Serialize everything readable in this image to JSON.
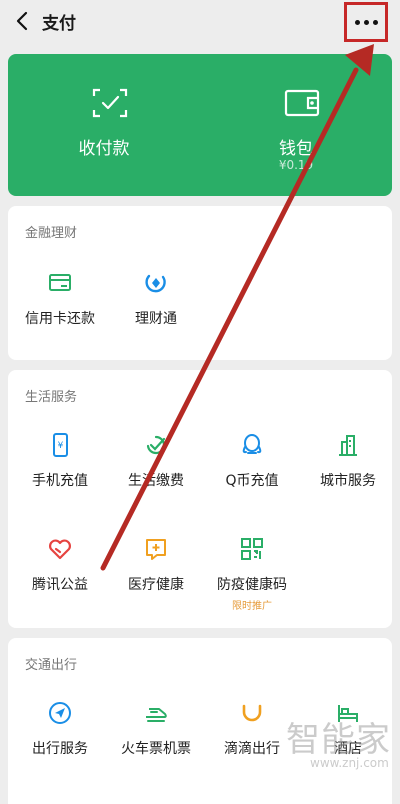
{
  "header": {
    "title": "支付"
  },
  "hero": {
    "items": [
      {
        "label": "收付款"
      },
      {
        "label": "钱包",
        "sub": "¥0.19"
      }
    ]
  },
  "finance": {
    "title": "金融理财",
    "items": [
      {
        "label": "信用卡还款"
      },
      {
        "label": "理财通"
      }
    ]
  },
  "life": {
    "title": "生活服务",
    "items": [
      {
        "label": "手机充值"
      },
      {
        "label": "生活缴费"
      },
      {
        "label": "Q币充值"
      },
      {
        "label": "城市服务"
      },
      {
        "label": "腾讯公益"
      },
      {
        "label": "医疗健康"
      },
      {
        "label": "防疫健康码",
        "tag": "限时推广"
      }
    ]
  },
  "transport": {
    "title": "交通出行",
    "items": [
      {
        "label": "出行服务"
      },
      {
        "label": "火车票机票"
      },
      {
        "label": "滴滴出行"
      },
      {
        "label": "酒店"
      }
    ]
  },
  "watermark": {
    "text": "智能家",
    "url": "www.znj.com"
  },
  "colors": {
    "brand_green": "#2aae67",
    "highlight_red": "#c62828",
    "tag_orange": "#e69b3a"
  }
}
